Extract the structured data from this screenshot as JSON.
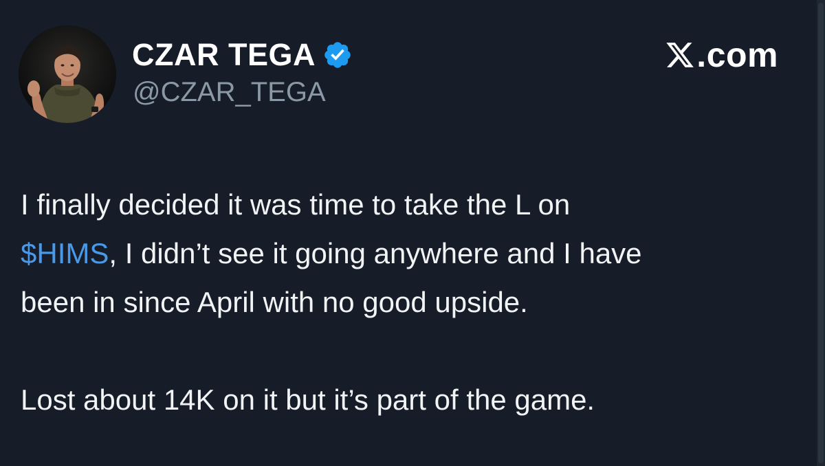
{
  "author": {
    "display_name": "CZAR TEGA",
    "handle": "@CZAR_TEGA",
    "verified": true,
    "verified_badge_color": "#1d9bf0",
    "avatar_icon": "profile-photo-avatar"
  },
  "brand": {
    "logo_icon": "x-logo-icon",
    "suffix": ".com"
  },
  "tweet": {
    "line1": "I finally decided it was time to take the L on",
    "cashtag": "$HIMS",
    "line2_rest": ", I didn’t see it going anywhere and I have",
    "line3": "been in since April with no good upside.",
    "line4": "Lost about 14K on it but it’s part of the game."
  },
  "colors": {
    "background": "#161d29",
    "text": "#f1f3f5",
    "secondary_text": "#8b98a5",
    "link": "#4a99e9"
  }
}
